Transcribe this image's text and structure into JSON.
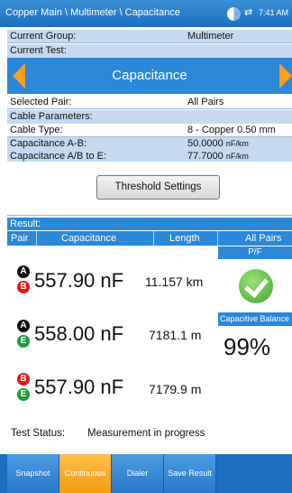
{
  "header": {
    "breadcrumb": "Copper Main \\ Multimeter \\ Capacitance",
    "network_icon": "⇄",
    "time": "7:41 AM"
  },
  "current_group": {
    "label": "Current Group:",
    "value": "Multimeter"
  },
  "current_test": {
    "label": "Current Test:",
    "name": "Capacitance"
  },
  "selected_pair": {
    "label": "Selected Pair:",
    "value": "All Pairs"
  },
  "cable_parameters": {
    "label": "Cable Parameters:"
  },
  "cable_type": {
    "label": "Cable Type:",
    "value": "8 - Copper 0.50 mm"
  },
  "cap_ab": {
    "label": "Capacitance A-B:",
    "value": "50.0000",
    "unit": "nF/km"
  },
  "cap_abe": {
    "label": "Capacitance A/B to E:",
    "value": "77.7000",
    "unit": "nF/km"
  },
  "threshold_button": "Threshold Settings",
  "result": {
    "label": "Result:",
    "columns": [
      "Pair",
      "Capacitance",
      "Length",
      "All Pairs"
    ],
    "pf_label": "P/F",
    "capacitive_balance_label": "Capacitive Balance",
    "capacitive_balance_value": "99%",
    "rows": [
      {
        "top": "A",
        "bottom": "B",
        "capacitance": "557.90 nF",
        "length": "11.157 km"
      },
      {
        "top": "A",
        "bottom": "E",
        "capacitance": "558.00 nF",
        "length": "7181.1 m"
      },
      {
        "top": "B",
        "bottom": "E",
        "capacitance": "557.90 nF",
        "length": "7179.9 m"
      }
    ]
  },
  "test_status": {
    "label": "Test Status:",
    "value": "Measurement in progress"
  },
  "tabs": [
    "Snapshot",
    "Continuous",
    "Dialer",
    "Save Result"
  ],
  "colors": {
    "accent": "#2b88d8",
    "highlight": "#c5d9f1",
    "active_tab": "#f39a10",
    "arrow": "#ff9e1b"
  }
}
